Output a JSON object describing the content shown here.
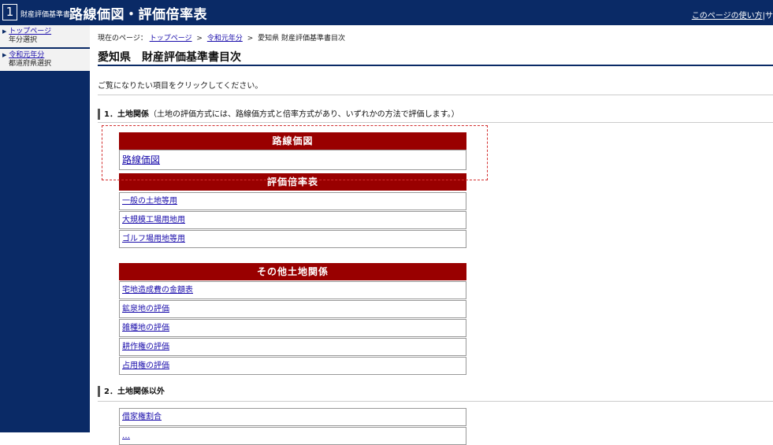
{
  "header": {
    "logo_number": "1",
    "logo_sub": "財産評価基準書",
    "logo_main": "路線価図・評価倍率表",
    "help_link": "このページの使い方",
    "help_sep": "|サ"
  },
  "sidebar": {
    "items": [
      {
        "link": "トップページ",
        "sub": "年分選択"
      },
      {
        "link": "令和元年分",
        "sub": "都道府県選択"
      }
    ]
  },
  "breadcrumb": {
    "prefix": "現在のページ：",
    "top": "トップページ",
    "sep1": ">",
    "year": "令和元年分",
    "sep2": ">",
    "current": "愛知県 財産評価基準書目次"
  },
  "page": {
    "title": "愛知県　財産評価基準書目次",
    "intro": "ご覧になりたい項目をクリックしてください。"
  },
  "section1": {
    "label": "1．土地関係",
    "note": "（土地の評価方式には、路線価方式と倍率方式があり、いずれかの方法で評価します。）"
  },
  "section2": {
    "label": "2．土地関係以外"
  },
  "groups": {
    "rosenka": {
      "header": "路線価図",
      "items": [
        "路線価図"
      ]
    },
    "bairitsu": {
      "header": "評価倍率表",
      "items": [
        "一般の土地等用",
        "大規模工場用地用",
        "ゴルフ場用地等用"
      ]
    },
    "other": {
      "header": "その他土地関係",
      "items": [
        "宅地造成費の金額表",
        "鉱泉地の評価",
        "雑種地の評価",
        "耕作権の評価",
        "占用権の評価"
      ]
    },
    "non_land": {
      "items": [
        "借家権割合",
        "…"
      ]
    }
  },
  "colors": {
    "navy": "#0a2a66",
    "group_header": "#990000",
    "highlight": "#d32f2f"
  }
}
